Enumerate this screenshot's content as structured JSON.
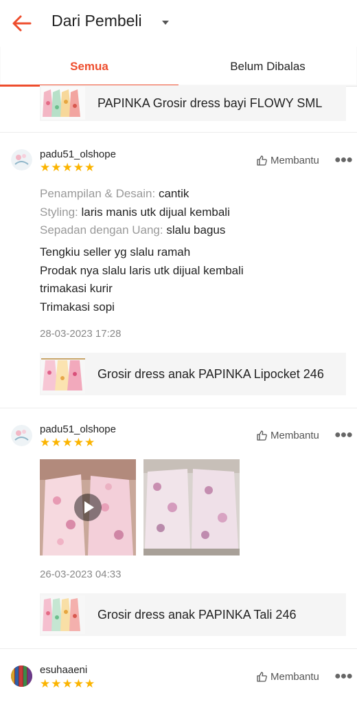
{
  "header": {
    "title": "Dari Pembeli"
  },
  "tabs": [
    {
      "label": "Semua",
      "active": true
    },
    {
      "label": "Belum Dibalas",
      "active": false
    }
  ],
  "colors": {
    "accent": "#ee4d2d",
    "star": "#fbb400"
  },
  "top_product": {
    "name": "PAPINKA Grosir dress bayi FLOWY SML"
  },
  "reviews": [
    {
      "username": "padu51_olshope",
      "rating": 5,
      "helpful_label": "Membantu",
      "attributes": [
        {
          "key": "Penampilan & Desain:",
          "value": "cantik"
        },
        {
          "key": "Styling:",
          "value": "laris manis utk dijual kembali"
        },
        {
          "key": "Sepadan dengan Uang:",
          "value": "slalu bagus"
        }
      ],
      "body_lines": [
        "Tengkiu seller yg slalu ramah",
        "Prodak nya slalu laris utk dijual kembali",
        "trimakasi kurir",
        "Trimakasi sopi"
      ],
      "date": "28-03-2023 17:28",
      "product": "Grosir dress anak PAPINKA Lipocket 246"
    },
    {
      "username": "padu51_olshope",
      "rating": 5,
      "helpful_label": "Membantu",
      "media": [
        "video",
        "photo"
      ],
      "date": "26-03-2023 04:33",
      "product": "Grosir dress anak PAPINKA Tali 246"
    },
    {
      "username": "esuhaaeni",
      "rating": 5,
      "helpful_label": "Membantu"
    }
  ]
}
